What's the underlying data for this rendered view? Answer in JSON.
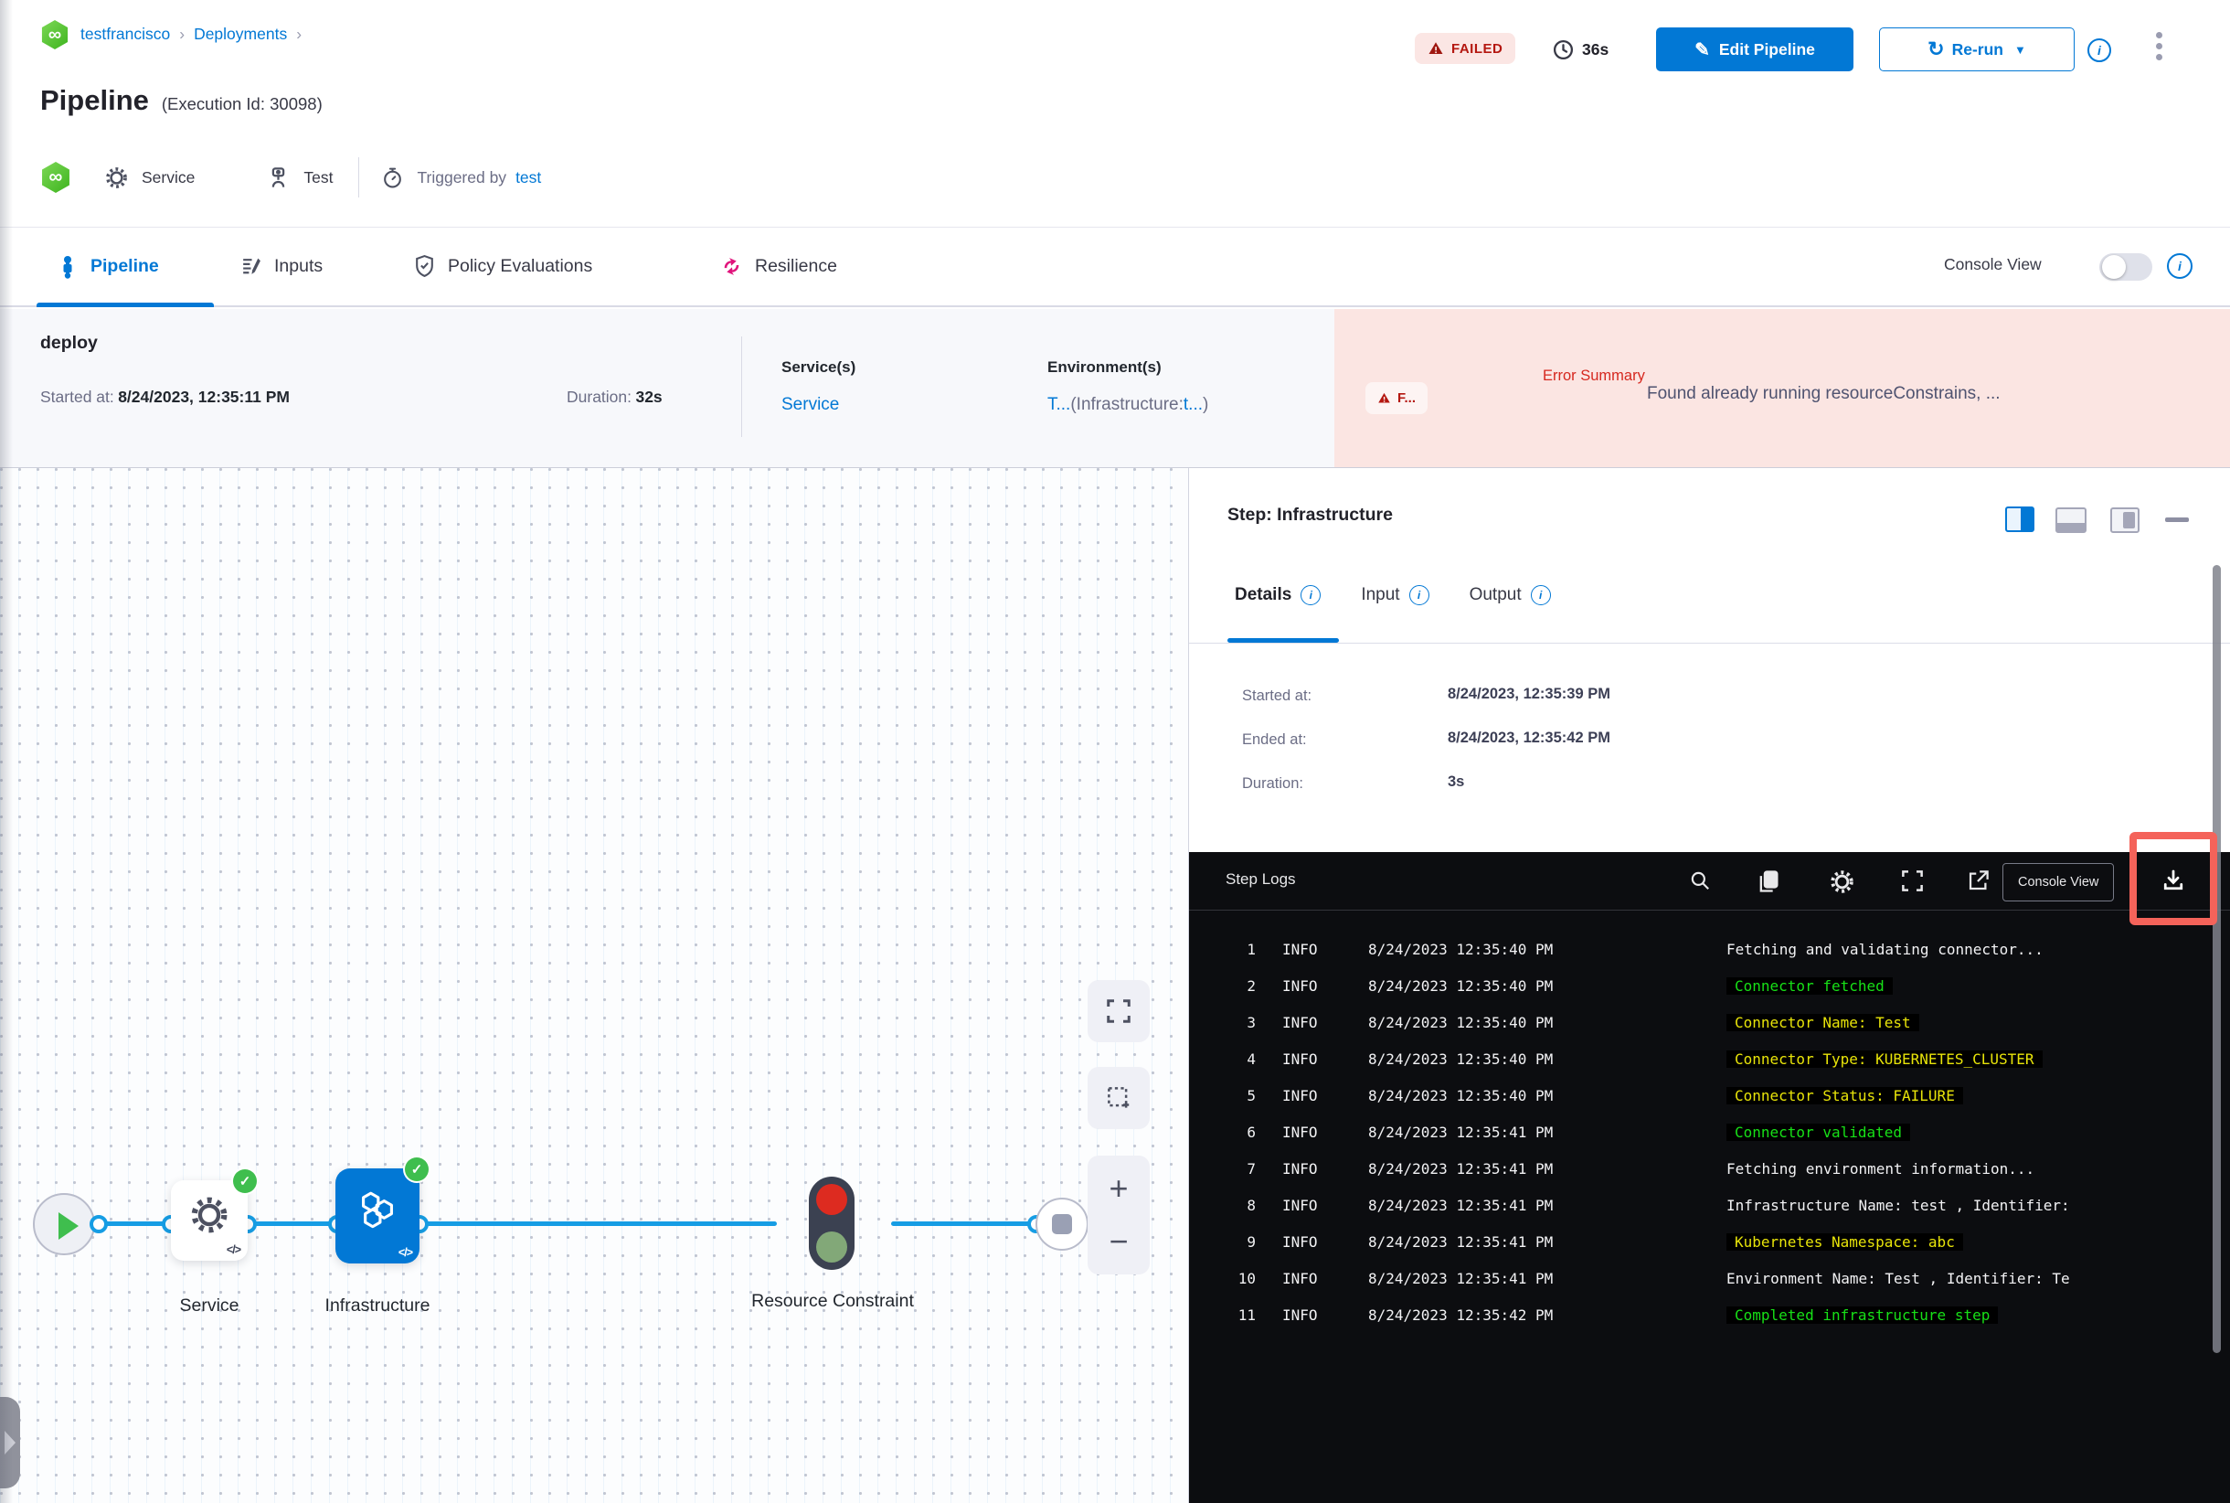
{
  "header": {
    "breadcrumb": {
      "project": "testfrancisco",
      "sep1": "›",
      "section": "Deployments",
      "sep2": "›"
    },
    "status_badge": "FAILED",
    "elapsed": "36s",
    "edit_pipeline": "Edit Pipeline",
    "rerun": "Re-run",
    "title": "Pipeline",
    "execution_id": "(Execution Id: 30098)",
    "meta": {
      "service": "Service",
      "test": "Test",
      "triggered_by": "Triggered by",
      "trigger_user": "test"
    }
  },
  "tabbar": {
    "pipeline": "Pipeline",
    "inputs": "Inputs",
    "policy": "Policy Evaluations",
    "resilience": "Resilience",
    "console_view": "Console View"
  },
  "summary": {
    "stage": "deploy",
    "started_label": "Started at:",
    "started": "8/24/2023, 12:35:11 PM",
    "duration_label": "Duration:",
    "duration": "32s",
    "services_label": "Service(s)",
    "service": "Service",
    "environments_label": "Environment(s)",
    "env_link1": "T...",
    "env_mid": "(Infrastructure:",
    "env_link2": "t...",
    "env_end": ")",
    "error_badge": "F...",
    "error_label": "Error Summary",
    "error_message": "Found already running resourceConstrains, ..."
  },
  "graph": {
    "service": "Service",
    "infrastructure": "Infrastructure",
    "resource_constraint": "Resource Constraint",
    "code_badge": "</>"
  },
  "panel": {
    "title": "Step: Infrastructure",
    "tab_details": "Details",
    "tab_input": "Input",
    "tab_output": "Output",
    "rows": [
      {
        "label": "Started at:",
        "value": "8/24/2023, 12:35:39 PM"
      },
      {
        "label": "Ended at:",
        "value": "8/24/2023, 12:35:42 PM"
      },
      {
        "label": "Duration:",
        "value": "3s"
      }
    ]
  },
  "logs": {
    "title": "Step Logs",
    "console_view": "Console View",
    "rows": [
      {
        "n": "1",
        "level": "INFO",
        "time": "8/24/2023 12:35:40 PM",
        "msg": "Fetching and validating connector...",
        "color": "white"
      },
      {
        "n": "2",
        "level": "INFO",
        "time": "8/24/2023 12:35:40 PM",
        "msg": "Connector fetched",
        "color": "green"
      },
      {
        "n": "3",
        "level": "INFO",
        "time": "8/24/2023 12:35:40 PM",
        "msg": "Connector Name: Test",
        "color": "yellow"
      },
      {
        "n": "4",
        "level": "INFO",
        "time": "8/24/2023 12:35:40 PM",
        "msg": "Connector Type: KUBERNETES_CLUSTER",
        "color": "yellow"
      },
      {
        "n": "5",
        "level": "INFO",
        "time": "8/24/2023 12:35:40 PM",
        "msg": "Connector Status: FAILURE",
        "color": "yellow"
      },
      {
        "n": "6",
        "level": "INFO",
        "time": "8/24/2023 12:35:41 PM",
        "msg": "Connector validated",
        "color": "green"
      },
      {
        "n": "7",
        "level": "INFO",
        "time": "8/24/2023 12:35:41 PM",
        "msg": "Fetching environment information...",
        "color": "white"
      },
      {
        "n": "8",
        "level": "INFO",
        "time": "8/24/2023 12:35:41 PM",
        "msg": "Infrastructure Name: test , Identifier:",
        "color": "white"
      },
      {
        "n": "9",
        "level": "INFO",
        "time": "8/24/2023 12:35:41 PM",
        "msg": "Kubernetes Namespace: abc",
        "color": "yellow"
      },
      {
        "n": "10",
        "level": "INFO",
        "time": "8/24/2023 12:35:41 PM",
        "msg": "Environment Name: Test , Identifier: Te",
        "color": "white"
      },
      {
        "n": "11",
        "level": "INFO",
        "time": "8/24/2023 12:35:42 PM",
        "msg": "Completed infrastructure step",
        "color": "green"
      }
    ]
  },
  "colors": {
    "primary": "#0278d5",
    "failed_red": "#b41710",
    "success_green": "#3fbe4e",
    "highlight_red": "#f4635a",
    "log_green": "#17e017",
    "log_yellow": "#e8e409"
  }
}
